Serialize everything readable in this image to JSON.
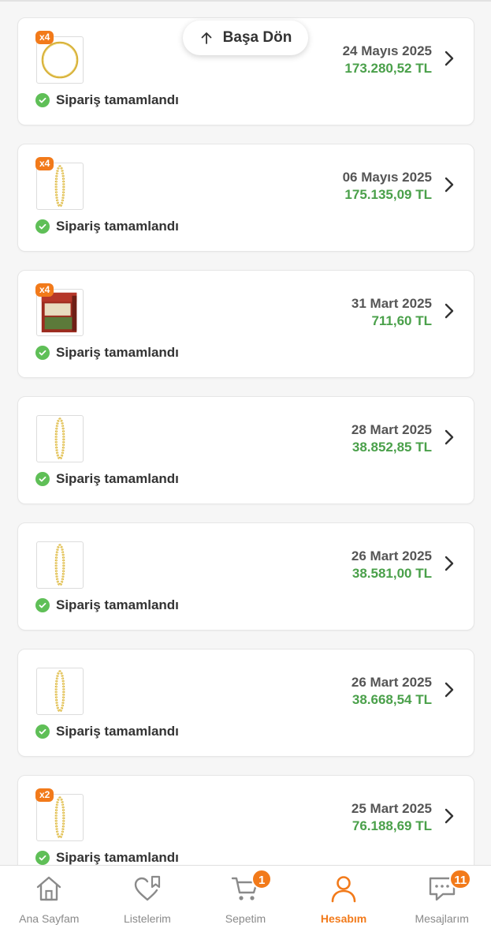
{
  "colors": {
    "accent": "#f27a1a",
    "price": "#4aa04a",
    "success": "#5fbf57"
  },
  "back_to_top": {
    "label": "Başa Dön",
    "icon": "arrow-up-icon"
  },
  "orders": [
    {
      "date": "24 Mayıs 2025",
      "price": "173.280,52 TL",
      "status": "Sipariş tamamlandı",
      "qty_badge": "x4",
      "product": "thin-gold-bangle"
    },
    {
      "date": "06 Mayıs 2025",
      "price": "175.135,09 TL",
      "status": "Sipariş tamamlandı",
      "qty_badge": "x4",
      "product": "twisted-gold-bangle"
    },
    {
      "date": "31 Mart 2025",
      "price": "711,60 TL",
      "status": "Sipariş tamamlandı",
      "qty_badge": "x4",
      "product": "tea-box"
    },
    {
      "date": "28 Mart 2025",
      "price": "38.852,85 TL",
      "status": "Sipariş tamamlandı",
      "qty_badge": "",
      "product": "twisted-gold-bangle"
    },
    {
      "date": "26 Mart 2025",
      "price": "38.581,00 TL",
      "status": "Sipariş tamamlandı",
      "qty_badge": "",
      "product": "twisted-gold-bangle"
    },
    {
      "date": "26 Mart 2025",
      "price": "38.668,54 TL",
      "status": "Sipariş tamamlandı",
      "qty_badge": "",
      "product": "twisted-gold-bangle"
    },
    {
      "date": "25 Mart 2025",
      "price": "76.188,69 TL",
      "status": "Sipariş tamamlandı",
      "qty_badge": "x2",
      "product": "twisted-gold-bangle"
    }
  ],
  "tabbar": [
    {
      "label": "Ana Sayfam",
      "icon": "home-icon",
      "badge": "",
      "active": false
    },
    {
      "label": "Listelerim",
      "icon": "heart-list-icon",
      "badge": "",
      "active": false
    },
    {
      "label": "Sepetim",
      "icon": "cart-icon",
      "badge": "1",
      "active": false
    },
    {
      "label": "Hesabım",
      "icon": "user-icon",
      "badge": "",
      "active": true
    },
    {
      "label": "Mesajlarım",
      "icon": "message-icon",
      "badge": "11",
      "active": false
    }
  ]
}
